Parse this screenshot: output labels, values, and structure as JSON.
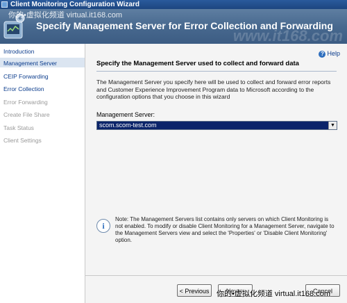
{
  "window": {
    "title": "Client Monitoring Configuration Wizard"
  },
  "header": {
    "title": "Specify Management Server for Error Collection and Forwarding"
  },
  "watermark": {
    "top": "你的•虚拟化频道 virtual.it168.com",
    "bottom": "你的•虚拟化频道 virtual.it168.com",
    "bg": "www.it168.com"
  },
  "nav": {
    "items": [
      {
        "label": "Introduction",
        "state": "link"
      },
      {
        "label": "Management Server",
        "state": "selected"
      },
      {
        "label": "CEIP Forwarding",
        "state": "link"
      },
      {
        "label": "Error Collection",
        "state": "link"
      },
      {
        "label": "Error Forwarding",
        "state": "disabled"
      },
      {
        "label": "Create File Share",
        "state": "disabled"
      },
      {
        "label": "Task Status",
        "state": "disabled"
      },
      {
        "label": "Client Settings",
        "state": "disabled"
      }
    ]
  },
  "help": {
    "label": "Help",
    "icon": "help-icon"
  },
  "main": {
    "heading": "Specify the Management Server used to collect and forward data",
    "description": "The Management Server you specify here will be used to collect and forward error reports and Customer Experience Improvement Program data to Microsoft according to the configuration options that you choose in this wizard",
    "server_label": "Management Server:",
    "server_value": "scom.scom-test.com",
    "note": "Note: The Management Servers list contains only servers on which Client Monitoring is not enabled. To modify or disable Client Monitoring for a Management Server, navigate to the Management Servers view and select the 'Properties' or 'Disable Client Monitoring' option."
  },
  "buttons": {
    "previous": "< Previous",
    "next": "Next >",
    "cancel": "Cancel"
  },
  "colors": {
    "title_bar": "#1d4680",
    "header": "#48698f",
    "selected_nav": "#dbe5f1",
    "link": "#0b3c8c",
    "select_bg": "#0b246a"
  }
}
